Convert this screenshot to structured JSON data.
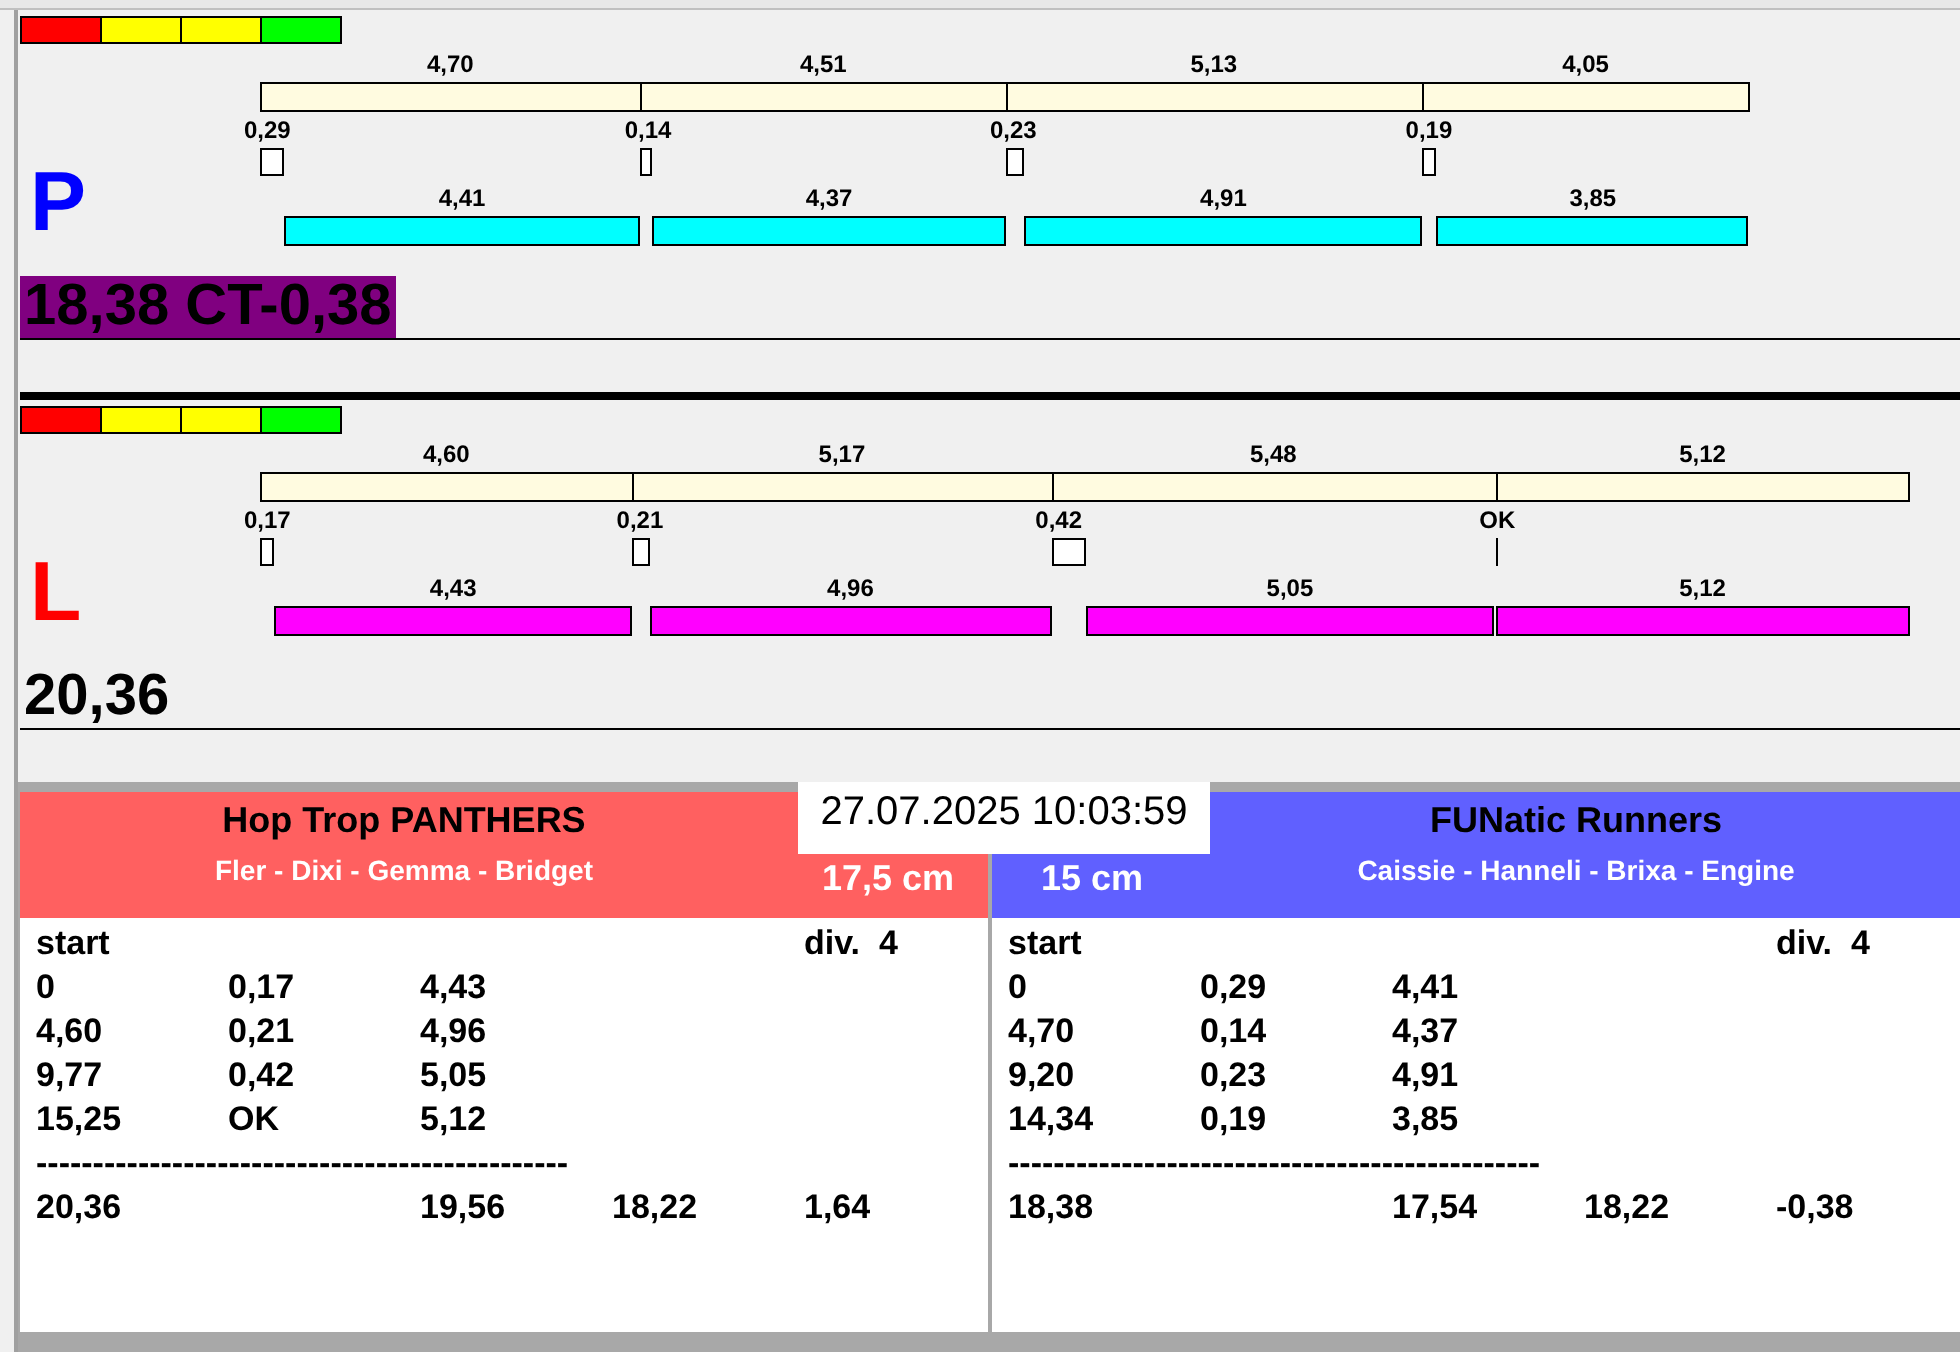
{
  "lanes": [
    {
      "letter": {
        "text": "P",
        "color": "#0000ff"
      },
      "color": "#00ffff",
      "total": "18,38 CT-0,38",
      "highlighted": true,
      "splits": [
        {
          "split": "4,70",
          "reaction": "0,29",
          "run": "4,41"
        },
        {
          "split": "4,51",
          "reaction": "0,14",
          "run": "4,37"
        },
        {
          "split": "5,13",
          "reaction": "0,23",
          "run": "4,91"
        },
        {
          "split": "4,05",
          "reaction": "0,19",
          "run": "3,85"
        }
      ]
    },
    {
      "letter": {
        "text": "L",
        "color": "#ff0000"
      },
      "color": "#ff00ff",
      "total": "20,36",
      "highlighted": false,
      "splits": [
        {
          "split": "4,60",
          "reaction": "0,17",
          "run": "4,43"
        },
        {
          "split": "5,17",
          "reaction": "0,21",
          "run": "4,96"
        },
        {
          "split": "5,48",
          "reaction": "0,42",
          "run": "5,05"
        },
        {
          "split": "5,12",
          "reaction": "OK",
          "run": "5,12"
        }
      ]
    }
  ],
  "clock": "27.07.2025 10:03:59",
  "teams": [
    {
      "name": "Hop Trop PANTHERS",
      "dogs": "Fler - Dixi - Gemma - Bridget",
      "distance": "17,5 cm",
      "color": "#ff6060",
      "start_label": "start",
      "division": "div.  4",
      "rows": [
        [
          "0",
          "0,17",
          "4,43"
        ],
        [
          "4,60",
          "0,21",
          "4,96"
        ],
        [
          "9,77",
          "0,42",
          "5,05"
        ],
        [
          "15,25",
          "OK",
          "5,12"
        ]
      ],
      "separator": "-----------------------------------------------",
      "totals": [
        "20,36",
        "19,56",
        "18,22",
        "1,64"
      ]
    },
    {
      "name": "FUNatic Runners",
      "dogs": "Caissie - Hanneli - Brixa - Engine",
      "distance": "15 cm",
      "color": "#6060ff",
      "start_label": "start",
      "division": "div.  4",
      "rows": [
        [
          "0",
          "0,29",
          "4,41"
        ],
        [
          "4,70",
          "0,14",
          "4,37"
        ],
        [
          "9,20",
          "0,23",
          "4,91"
        ],
        [
          "14,34",
          "0,19",
          "3,85"
        ]
      ],
      "separator": "-----------------------------------------------",
      "totals": [
        "18,38",
        "17,54",
        "18,22",
        "-0,38"
      ]
    }
  ]
}
